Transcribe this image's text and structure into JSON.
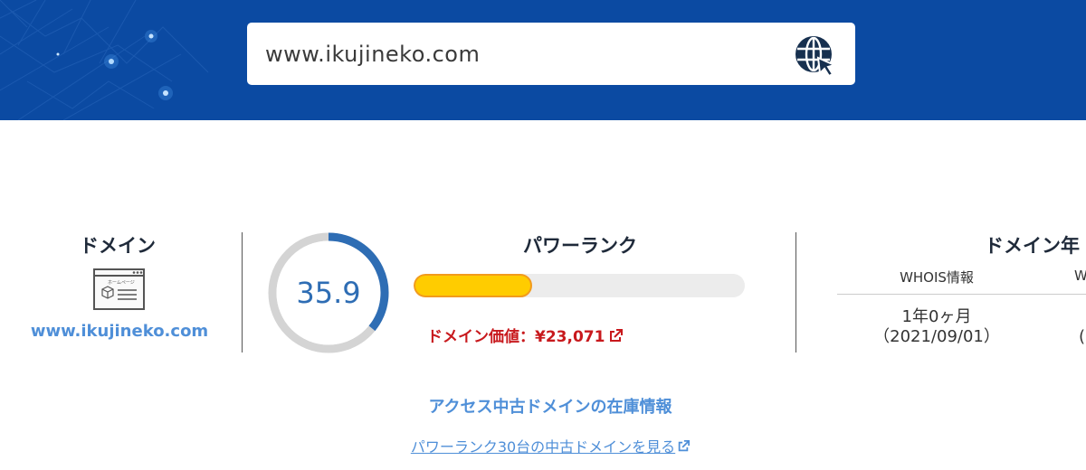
{
  "search": {
    "value": "www.ikujineko.com"
  },
  "colors": {
    "header_bg": "#0b4aa2",
    "accent_blue": "#4f8fd8",
    "gauge_blue": "#2e6db4",
    "bar_fill": "#ffcc00",
    "price_red": "#c8191d"
  },
  "domain": {
    "title": "ドメイン",
    "icon": "homepage-window-icon",
    "icon_caption": "ホームページ",
    "link": "www.ikujineko.com"
  },
  "power_rank": {
    "title": "パワーランク",
    "score": "35.9",
    "gauge_fraction": 0.359,
    "bar_fraction": 0.359,
    "value_label": "ドメイン価値：",
    "value_amount": "¥23,071"
  },
  "age": {
    "title": "ドメイン年",
    "col1_label": "WHOIS情報",
    "col2_label": "W",
    "col1_value_line1": "1年0ヶ月",
    "col1_value_line2": "（2021/09/01）",
    "col2_value_line2": "("
  },
  "stock": {
    "title": "アクセス中古ドメインの在庫情報",
    "link": "パワーランク30台の中古ドメインを見る"
  }
}
